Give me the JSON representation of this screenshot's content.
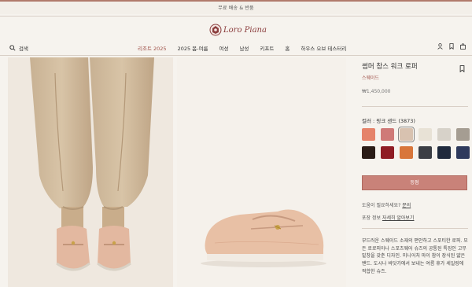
{
  "promo": {
    "text": "무료 배송 & 반품"
  },
  "brand": {
    "name": "Loro Piana"
  },
  "nav": {
    "search_label": "검색",
    "items": [
      {
        "label": "리조트 2025",
        "active": true
      },
      {
        "label": "2025 봄-여름",
        "active": false
      },
      {
        "label": "여성",
        "active": false
      },
      {
        "label": "남성",
        "active": false
      },
      {
        "label": "키프트",
        "active": false
      },
      {
        "label": "홈",
        "active": false
      },
      {
        "label": "하우스 오브 테스터리",
        "active": false
      }
    ],
    "icons": [
      "person-icon",
      "bookmark-icon",
      "shopping-bag-icon"
    ]
  },
  "product": {
    "name": "썸머 참스 워크 로퍼",
    "material": "스웨이드",
    "price": "₩1,450,000",
    "color_label": "컬러 : 핑크 샌드 (3873)",
    "swatches": [
      {
        "color": "#e5836a",
        "selected": false
      },
      {
        "color": "#cf7a78",
        "selected": false
      },
      {
        "color": "#d8c2b0",
        "selected": true
      },
      {
        "color": "#e8e2d6",
        "selected": false
      },
      {
        "color": "#d7d2c9",
        "selected": false
      },
      {
        "color": "#a59d92",
        "selected": false
      },
      {
        "color": "#2a1c17",
        "selected": false
      },
      {
        "color": "#8f1c24",
        "selected": false
      },
      {
        "color": "#d8763b",
        "selected": false
      },
      {
        "color": "#3b3e45",
        "selected": false
      },
      {
        "color": "#1f2a3d",
        "selected": false
      },
      {
        "color": "#2e3a5c",
        "selected": false
      }
    ],
    "buy_label": "등점",
    "help_text": "도움이 필요하세요?",
    "help_link": "문의",
    "packaging_text": "포장 정보",
    "packaging_link": "자세히 알아보기",
    "description": "부드러운 스웨이드 소재의 편안하고 스포티한 로퍼. 모든 로로피아나 스포츠웨어 슈즈의 공통된 특징인 고무 밑창을 갖춘 디자인. 미니어처 마이 참이 장식된 얇은 밴드. 도시나 바닷가에서 보내는 여름 휴가 세일링에 적합한 슈즈."
  },
  "colors": {
    "accent": "#a0524a",
    "button": "#c98279",
    "background": "#f6f3ee"
  }
}
